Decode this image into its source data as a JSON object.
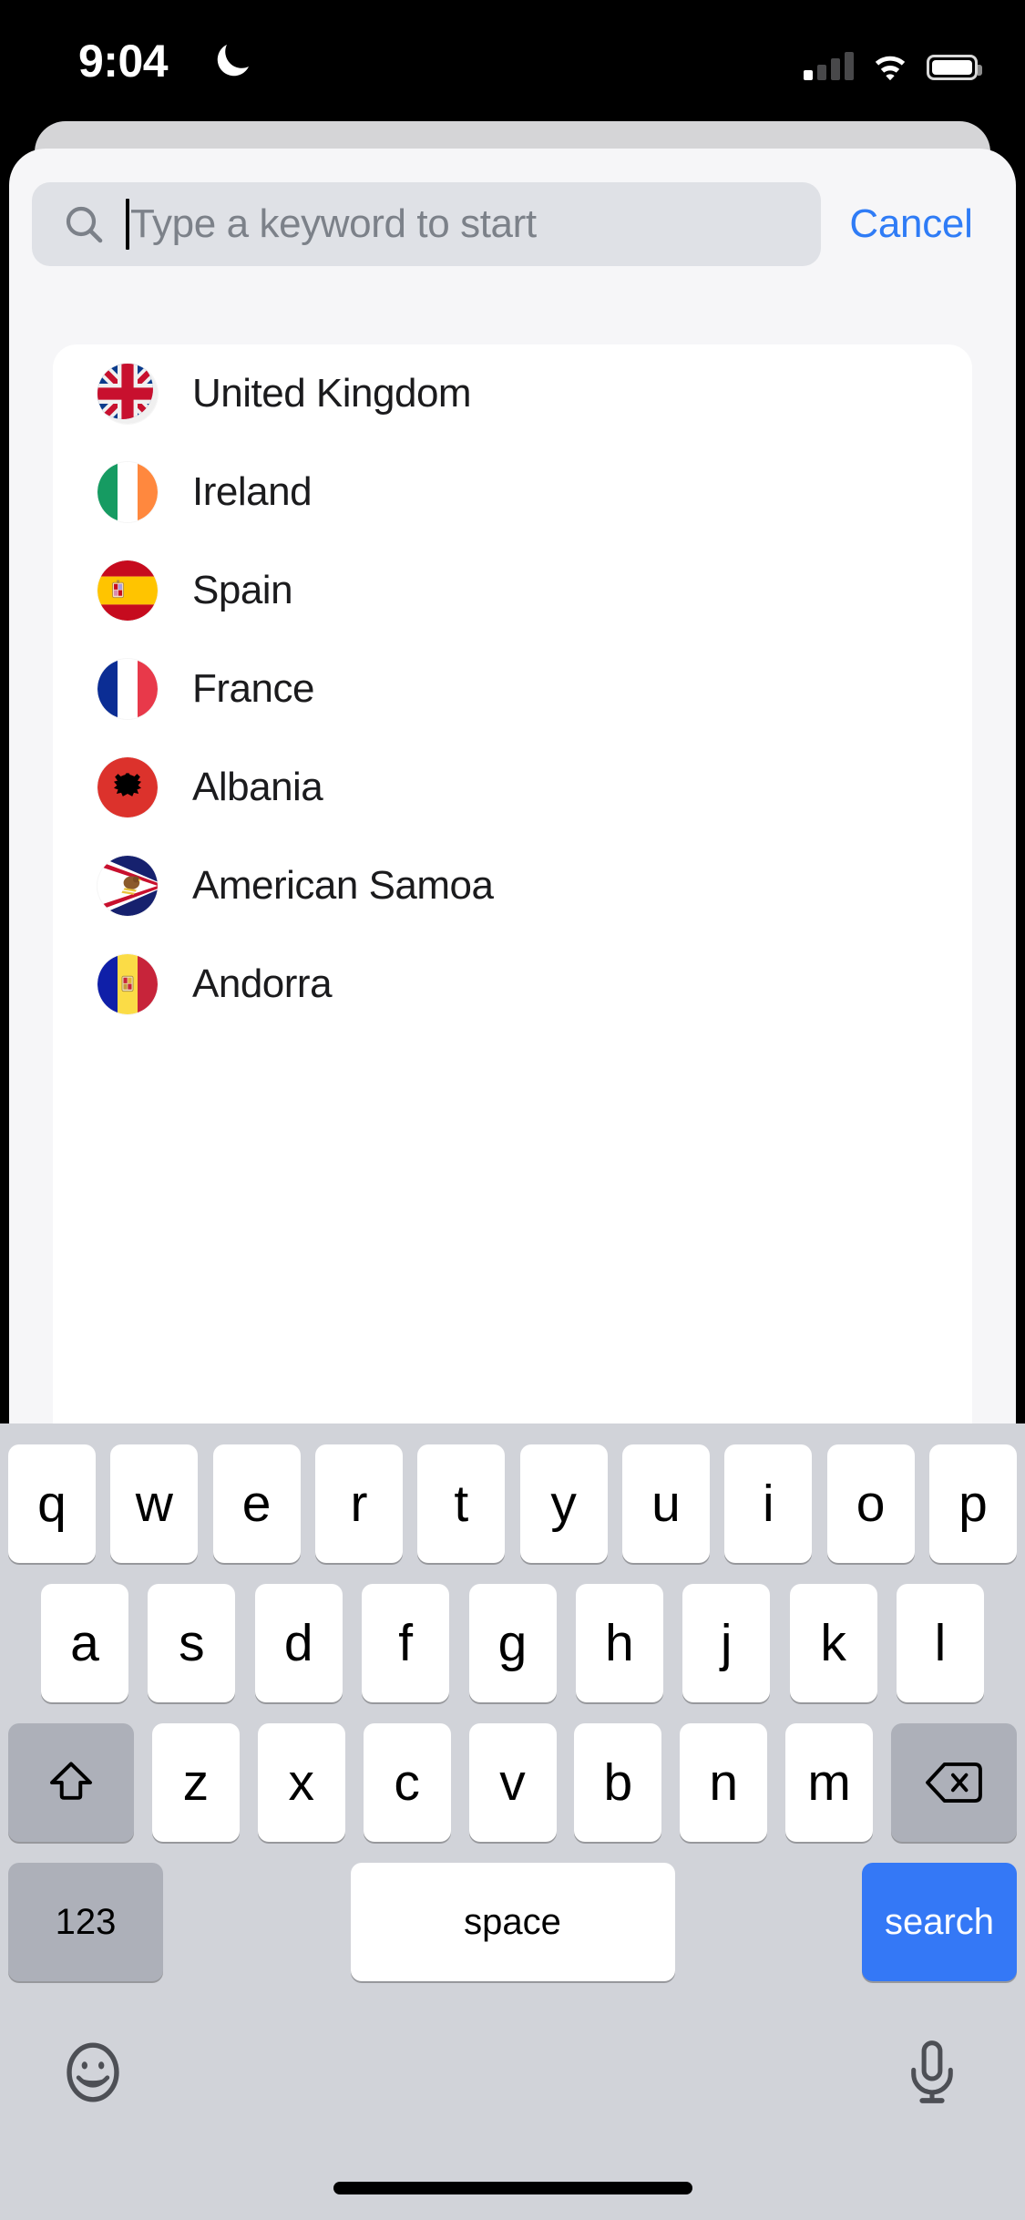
{
  "status_bar": {
    "time": "9:04",
    "dnd_icon": "moon-icon",
    "cellular_icon": "cellular-signal-icon",
    "cellular_bars_active": 1,
    "cellular_bars_total": 4,
    "wifi_icon": "wifi-icon",
    "battery_icon": "battery-icon",
    "battery_level_percent": 95
  },
  "search": {
    "placeholder": "Type a keyword to start",
    "value": "",
    "icon": "search-icon",
    "cancel_label": "Cancel",
    "cancel_color": "#2f7cf6"
  },
  "results": {
    "items": [
      {
        "name": "United Kingdom",
        "flag": "flag-united-kingdom"
      },
      {
        "name": "Ireland",
        "flag": "flag-ireland"
      },
      {
        "name": "Spain",
        "flag": "flag-spain"
      },
      {
        "name": "France",
        "flag": "flag-france"
      },
      {
        "name": "Albania",
        "flag": "flag-albania"
      },
      {
        "name": "American Samoa",
        "flag": "flag-american-samoa"
      },
      {
        "name": "Andorra",
        "flag": "flag-andorra"
      }
    ]
  },
  "keyboard": {
    "row1": [
      "q",
      "w",
      "e",
      "r",
      "t",
      "y",
      "u",
      "i",
      "o",
      "p"
    ],
    "row2": [
      "a",
      "s",
      "d",
      "f",
      "g",
      "h",
      "j",
      "k",
      "l"
    ],
    "row3": [
      "z",
      "x",
      "c",
      "v",
      "b",
      "n",
      "m"
    ],
    "shift_icon": "shift-icon",
    "delete_icon": "delete-icon",
    "numeric_label": "123",
    "space_label": "space",
    "return_label": "search",
    "return_color": "#3478f6",
    "emoji_icon": "emoji-icon",
    "dictation_icon": "microphone-icon"
  },
  "home_indicator": "home-indicator"
}
